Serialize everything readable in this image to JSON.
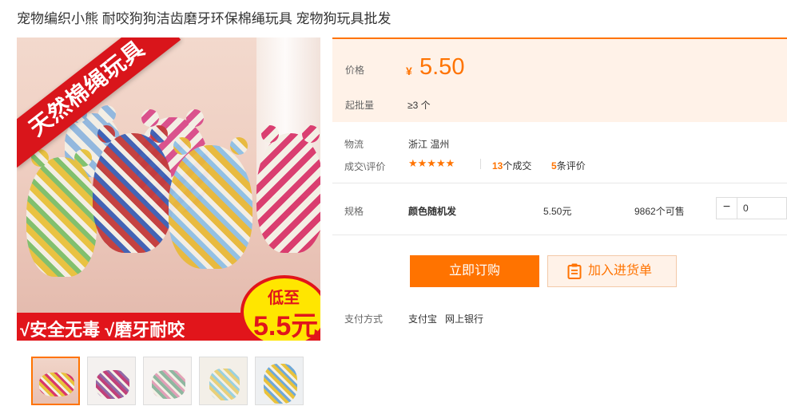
{
  "product": {
    "title": "宠物编织小熊 耐咬狗狗洁齿磨牙环保棉绳玩具 宠物狗玩具批发"
  },
  "gallery": {
    "banner_text": "天然棉绳玩具",
    "bottom_text": "√安全无毒 √磨牙耐咬",
    "badge_line1": "低至",
    "badge_line2": "5.5元"
  },
  "price": {
    "label": "价格",
    "currency": "¥",
    "value": "5.50",
    "moq_label": "起批量",
    "moq_value": "≥3 个"
  },
  "logistics": {
    "label": "物流",
    "value": "浙江 温州"
  },
  "reviews": {
    "label": "成交\\评价",
    "stars": "★★★★★",
    "rating": 5,
    "deals_num": "13",
    "deals_suffix": "个成交",
    "reviews_num": "5",
    "reviews_suffix": "条评价"
  },
  "spec": {
    "label": "规格",
    "name": "颜色随机发",
    "price": "5.50元",
    "stock": "9862个可售",
    "quantity": "0",
    "minus": "−"
  },
  "actions": {
    "buy_label": "立即订购",
    "cart_label": "加入进货单"
  },
  "payment": {
    "label": "支付方式",
    "methods": [
      "支付宝",
      "网上银行"
    ]
  },
  "colors": {
    "accent": "#ff7300",
    "price_bg": "#fff2e8"
  }
}
